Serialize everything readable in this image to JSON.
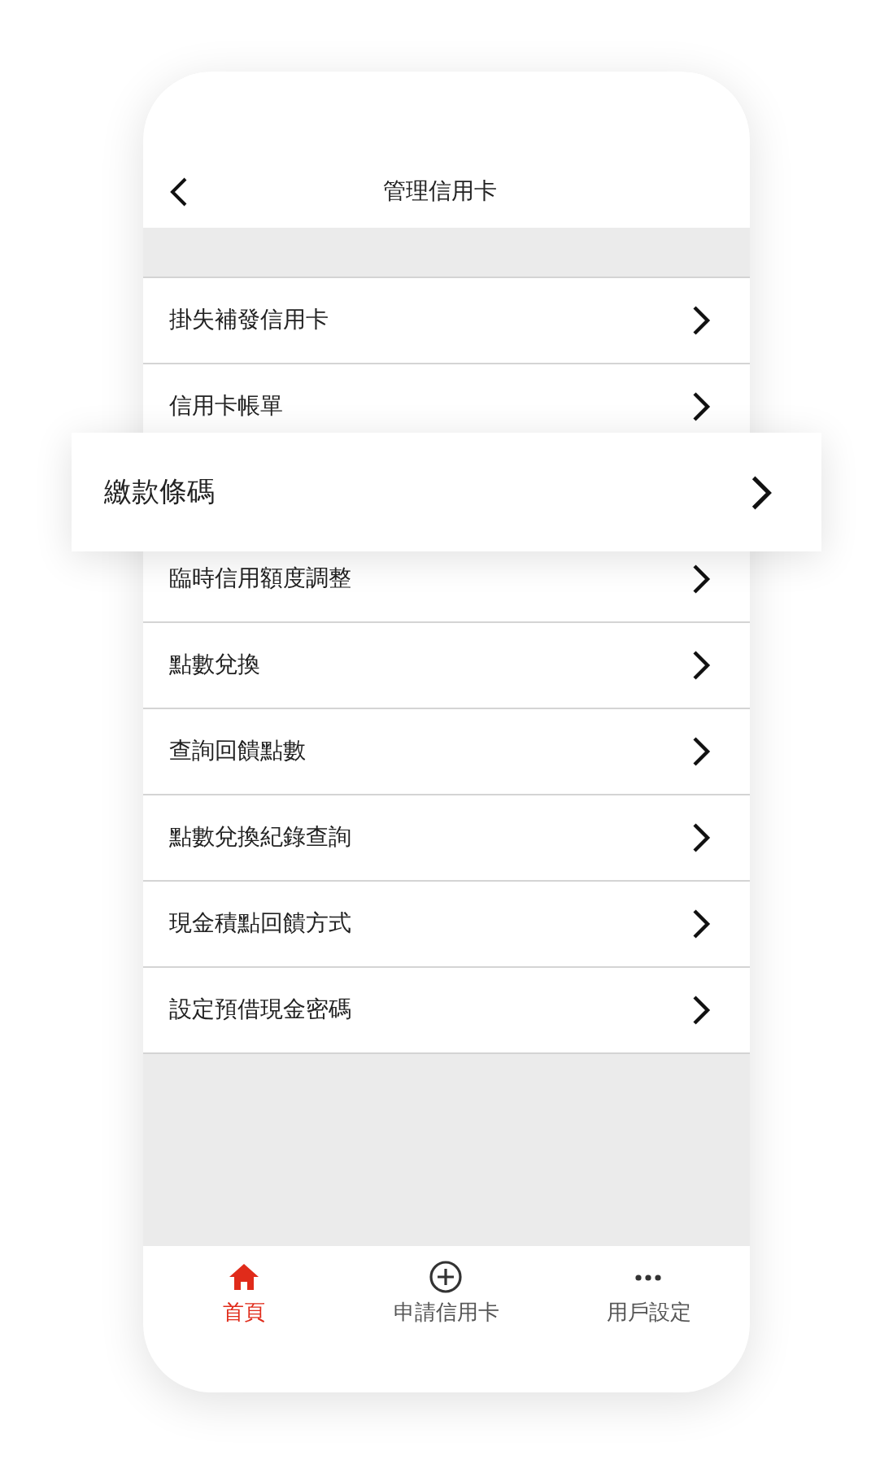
{
  "header": {
    "title": "管理信用卡"
  },
  "menu_items": [
    {
      "label": "掛失補發信用卡",
      "highlighted": false
    },
    {
      "label": "信用卡帳單",
      "highlighted": false
    },
    {
      "label": "繳款條碼",
      "highlighted": true
    },
    {
      "label": "臨時信用額度調整",
      "highlighted": false
    },
    {
      "label": "點數兌換",
      "highlighted": false
    },
    {
      "label": "查詢回饋點數",
      "highlighted": false
    },
    {
      "label": "點數兌換紀錄查詢",
      "highlighted": false
    },
    {
      "label": "現金積點回饋方式",
      "highlighted": false
    },
    {
      "label": "設定預借現金密碼",
      "highlighted": false
    }
  ],
  "tab_bar": [
    {
      "kind": "home",
      "label": "首頁",
      "selected": true
    },
    {
      "kind": "add",
      "label": "申請信用卡",
      "selected": false
    },
    {
      "kind": "more",
      "label": "用戶設定",
      "selected": false
    }
  ]
}
